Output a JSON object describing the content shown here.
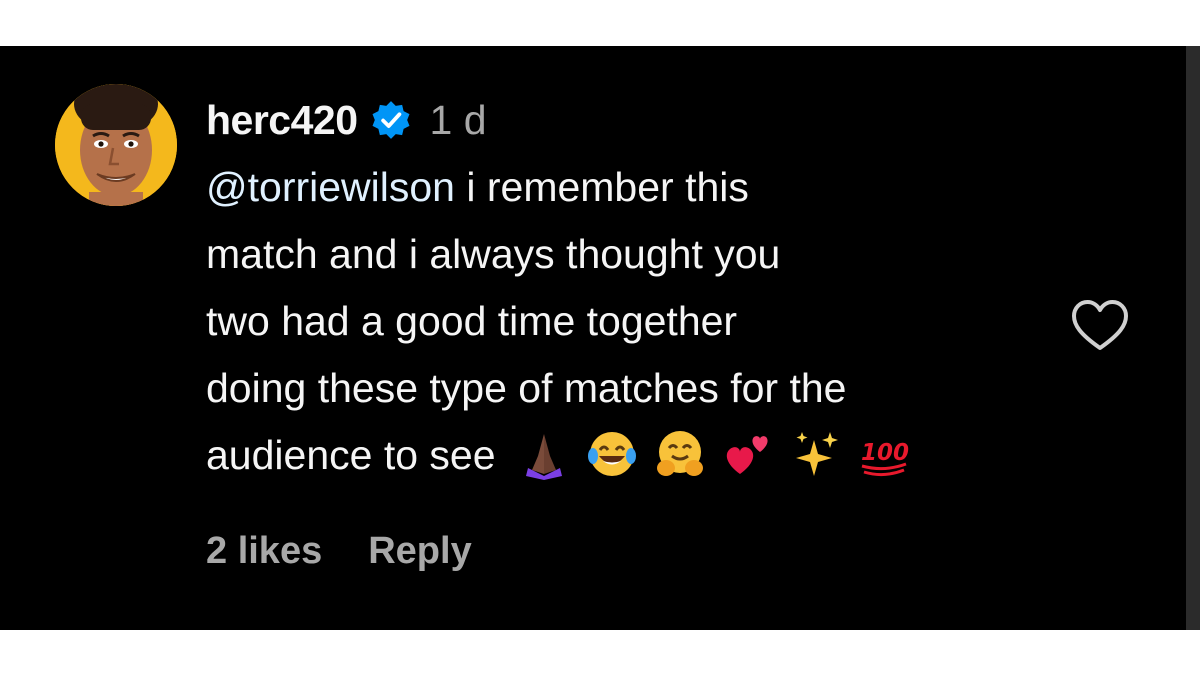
{
  "comment": {
    "username": "herc420",
    "time": "1 d",
    "mention": "@torriewilson",
    "lines": [
      " i remember this",
      "match and i always thought you",
      "two had a good time together",
      "doing these type of matches for the",
      "audience to see"
    ],
    "emojis": [
      "folded-hands",
      "tears-of-joy",
      "hugging-face",
      "two-hearts",
      "sparkles",
      "hundred-points"
    ],
    "likes_label": "2 likes",
    "reply_label": "Reply"
  },
  "colors": {
    "background": "#000000",
    "text": "#f5f5f5",
    "muted": "#a8a8a8",
    "verified": "#0095f6"
  }
}
